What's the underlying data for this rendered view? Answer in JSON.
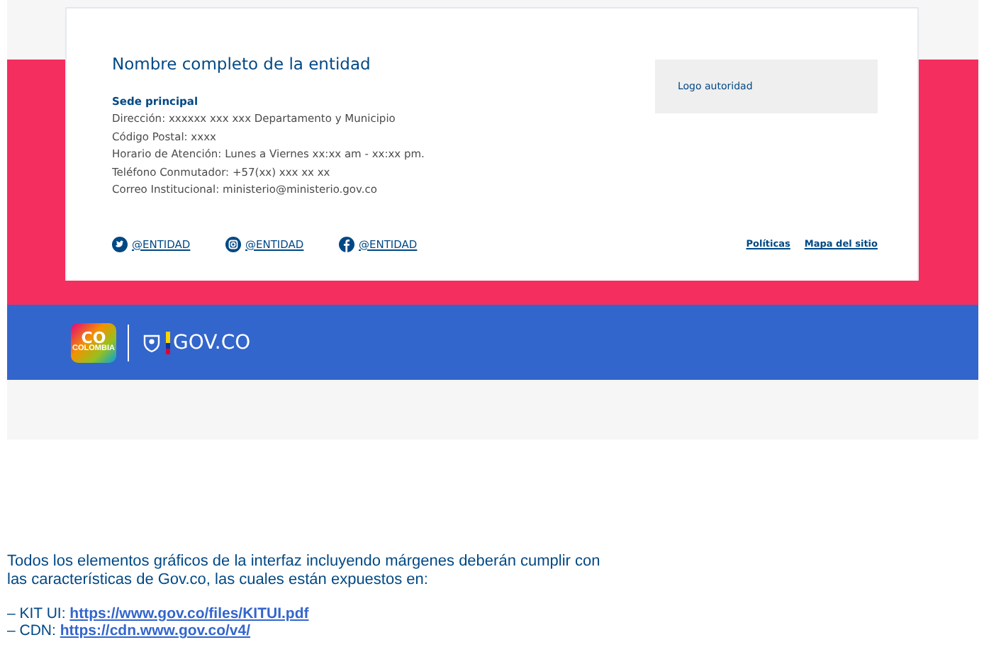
{
  "entity": {
    "title": "Nombre completo de la entidad",
    "office_heading": "Sede principal",
    "details": [
      "Dirección: xxxxxx xxx xxx Departamento y Municipio",
      "Código Postal: xxxx",
      "Horario de Atención: Lunes a Viernes xx:xx am - xx:xx pm.",
      "Teléfono Conmutador: +57(xx) xxx xx xx",
      "Correo Institucional: ministerio@ministerio.gov.co"
    ],
    "authority_logo": "Logo autoridad"
  },
  "social": [
    {
      "kind": "twitter",
      "handle": "@ENTIDAD"
    },
    {
      "kind": "instagram",
      "handle": "@ENTIDAD"
    },
    {
      "kind": "facebook",
      "handle": "@ENTIDAD"
    }
  ],
  "footer_links": [
    "Políticas",
    "Mapa del sitio"
  ],
  "brand_bar": {
    "co_logo": "CO",
    "co_logo_sub": "COLOMBIA",
    "gov_logo": "GOV.CO"
  },
  "note": {
    "text": "Todos los elementos gráficos de la interfaz incluyendo márgenes deberán cumplir con las características de Gov.co, las cuales están expuestos en:",
    "links": [
      {
        "label": "– KIT UI:",
        "url": "https://www.gov.co/files/KITUI.pdf"
      },
      {
        "label": "– CDN:",
        "url": "https://cdn.www.gov.co/v4/"
      }
    ]
  }
}
